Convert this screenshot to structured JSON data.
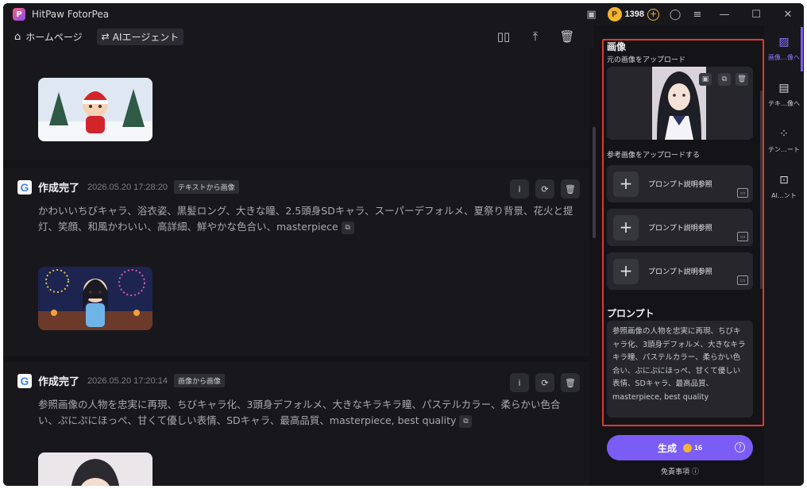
{
  "app": {
    "title": "HitPaw FotorPea",
    "coins": "1398"
  },
  "nav": {
    "home": "ホームページ",
    "agent": "AIエージェント"
  },
  "feed": {
    "cards": [
      {
        "status": "作成完了",
        "date": "2026.05.20 17:28:20",
        "tag": "テキストから画像",
        "prompt": "かわいいちびキャラ、浴衣姿、黒髪ロング、大きな瞳、2.5頭身SDキャラ、スーパーデフォルメ、夏祭り背景、花火と提灯、笑顔、和風かわいい、高詳細、鮮やかな色合い、masterpiece"
      },
      {
        "status": "作成完了",
        "date": "2026.05.20 17:20:14",
        "tag": "画像から画像",
        "prompt": "参照画像の人物を忠実に再現、ちびキャラ化、3頭身デフォルメ、大きなキラキラ瞳、パステルカラー、柔らかい色合い、ぷにぷにほっぺ、甘くて優しい表情、SDキャラ、最高品質、masterpiece, best quality"
      }
    ]
  },
  "panel": {
    "image_section": "画像",
    "upload_label": "元の画像をアップロード",
    "ref_label": "参考画像をアップロードする",
    "ref_items": [
      "プロンプト説明参照",
      "プロンプト説明参照",
      "プロンプト説明参照"
    ],
    "prompt_section": "プロンプト",
    "prompt_text": "参照画像の人物を忠実に再現、ちびキャラ化、3頭身デフォルメ、大きなキラキラ瞳、パステルカラー、柔らかい色合い、ぷにぷにほっぺ、甘くて優しい表情、SDキャラ、最高品質、masterpiece, best quality",
    "generate_label": "生成",
    "generate_cost": "16",
    "disclaimer": "免責事項"
  },
  "rail": {
    "items": [
      "画像…像へ",
      "テキ…像へ",
      "テン…ート",
      "AI…ント"
    ]
  },
  "colors": {
    "accent": "#7b5cf5",
    "highlight_border": "#e0392f",
    "coin": "#f2b530"
  }
}
